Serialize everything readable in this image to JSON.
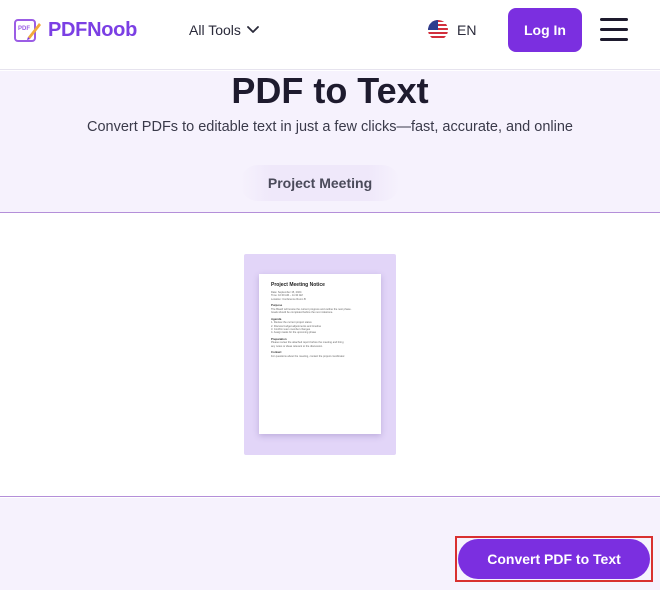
{
  "header": {
    "logo_text": "PDFNoob",
    "logo_badge": "PDF",
    "all_tools_label": "All Tools",
    "language_label": "EN",
    "login_label": "Log In"
  },
  "hero": {
    "title": "PDF to Text",
    "subtitle": "Convert PDFs to editable text in just a few clicks—fast, accurate, and online",
    "file_name": "Project Meeting"
  },
  "preview": {
    "doc_title": "Project Meeting Notice",
    "lines": [
      {
        "type": "line",
        "text": "Date: September 15, 2024"
      },
      {
        "type": "line",
        "text": "Time: 10:00 AM – 11:30 AM"
      },
      {
        "type": "line",
        "text": "Location: Conference Room B"
      },
      {
        "type": "head",
        "text": "Purpose"
      },
      {
        "type": "line",
        "text": "The Board will review the current progress and outline the next phase."
      },
      {
        "type": "line",
        "text": "Goals should be completed before the next milestone."
      },
      {
        "type": "head",
        "text": "Agenda"
      },
      {
        "type": "line",
        "text": "1. Review the current project status"
      },
      {
        "type": "line",
        "text": "2. Discuss budget adjustments and timeline"
      },
      {
        "type": "line",
        "text": "3. Confirm team member changes"
      },
      {
        "type": "line",
        "text": "4. Assign tasks for the upcoming phase"
      },
      {
        "type": "head",
        "text": "Preparation"
      },
      {
        "type": "line",
        "text": "Please review the attached report before the meeting and bring"
      },
      {
        "type": "line",
        "text": "any notes or ideas relevant to the discussion."
      },
      {
        "type": "head",
        "text": "Contact"
      },
      {
        "type": "line",
        "text": "For questions about the meeting, contact the project coordinator."
      }
    ]
  },
  "actions": {
    "convert_label": "Convert PDF to Text"
  },
  "colors": {
    "brand": "#7b2fe0",
    "hero_bg": "#f6f2fd",
    "highlight_outline": "#d93030"
  },
  "icons": {
    "logo": "pdf-pen-logo-icon",
    "dropdown": "chevron-down-icon",
    "language": "us-flag-icon",
    "menu": "hamburger-menu-icon"
  }
}
